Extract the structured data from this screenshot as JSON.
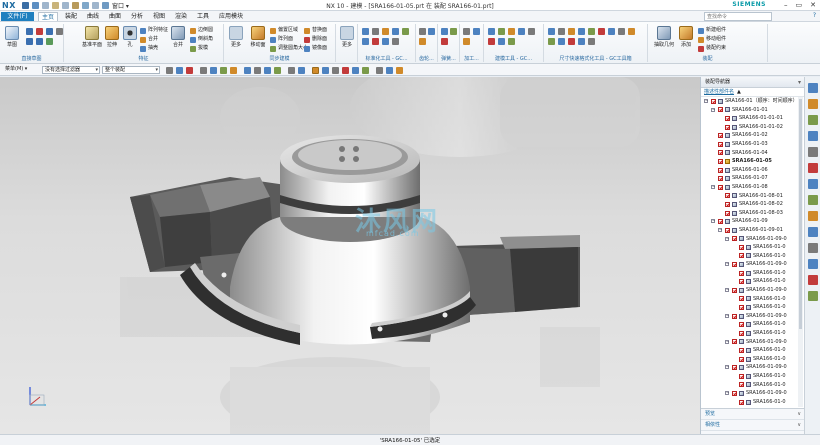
{
  "app": {
    "logo": "NX",
    "window_menu": "窗口 ▾",
    "title": "NX 10 - 建模 - [SRA166-01-05.prt 在 装配 SRA166-01.prt]",
    "brand": "SIEMENS",
    "window_controls": [
      "–",
      "▭",
      "✕"
    ]
  },
  "tabs": [
    {
      "label": "文件(F)",
      "kind": "file"
    },
    {
      "label": "主页",
      "kind": "active"
    },
    {
      "label": "装配"
    },
    {
      "label": "曲线"
    },
    {
      "label": "曲面"
    },
    {
      "label": "分析"
    },
    {
      "label": "视图"
    },
    {
      "label": "渲染"
    },
    {
      "label": "工具"
    },
    {
      "label": "应用模块"
    }
  ],
  "command_search": {
    "placeholder": "查找命令"
  },
  "ribbon": {
    "groups": [
      {
        "label": "直接草图"
      },
      {
        "label": "特征"
      },
      {
        "label": "同步建模"
      },
      {
        "label": "标准化工具 - GC..."
      },
      {
        "label": "齿轮..."
      },
      {
        "label": "弹簧..."
      },
      {
        "label": "加工..."
      },
      {
        "label": "建模工具 - GC..."
      },
      {
        "label": "尺寸快速格式化工具 - GC工具箱"
      },
      {
        "label": "装配"
      }
    ],
    "big_buttons": {
      "sketch": "草图",
      "datum_plane": "基准平面",
      "extrude": "拉伸",
      "hole": "孔",
      "combine": "合并",
      "move_face": "移动面",
      "more": "更多",
      "more2": "更多",
      "more3": "更多",
      "assembly_nav": "抽取几何",
      "add": "添加"
    },
    "small_items": {
      "array_feature": "阵列特征",
      "boolean": "合并",
      "shell": "抽壳",
      "edge_blend": "边倒圆",
      "chamfer": "倒斜角",
      "draft": "拔模",
      "offset_region": "偏置区域",
      "replace_face": "替换面",
      "resize_blend": "调整圆角大小",
      "delete_face": "删除面",
      "pattern_face": "阵列面",
      "mirror_face": "镜像面",
      "move_comp": "移动组件",
      "assembly_constraints": "装配约束",
      "new_component": "新建组件"
    }
  },
  "toolbar": {
    "menu_label": "菜单(M) ▾",
    "filter_value": "没有选择过滤器",
    "scope_value": "整个装配"
  },
  "viewport": {
    "watermark_text": "沐风网",
    "watermark_url": "mfcad.com"
  },
  "navigator": {
    "title": "装配导航器",
    "column_label": "描述性部件名",
    "sort_indicator": "▲",
    "nodes": [
      {
        "label": "SRA166-01（顺序：时间顺序）",
        "level": 0,
        "exp": "−",
        "type": "assembly"
      },
      {
        "label": "SRA166-01-01",
        "level": 1,
        "exp": "−",
        "type": "assembly"
      },
      {
        "label": "SRA166-01-01-01",
        "level": 2,
        "type": "part"
      },
      {
        "label": "SRA166-01-01-02",
        "level": 2,
        "type": "part"
      },
      {
        "label": "SRA166-01-02",
        "level": 1,
        "type": "part"
      },
      {
        "label": "SRA166-01-03",
        "level": 1,
        "type": "part"
      },
      {
        "label": "SRA166-01-04",
        "level": 1,
        "type": "part"
      },
      {
        "label": "SRA166-01-05",
        "level": 1,
        "type": "active",
        "bold": true
      },
      {
        "label": "SRA166-01-06",
        "level": 1,
        "type": "part"
      },
      {
        "label": "SRA166-01-07",
        "level": 1,
        "type": "part"
      },
      {
        "label": "SRA166-01-08",
        "level": 1,
        "exp": "−",
        "type": "assembly"
      },
      {
        "label": "SRA166-01-08-01",
        "level": 2,
        "type": "part"
      },
      {
        "label": "SRA166-01-08-02",
        "level": 2,
        "type": "part"
      },
      {
        "label": "SRA166-01-08-03",
        "level": 2,
        "type": "part"
      },
      {
        "label": "SRA166-01-09",
        "level": 1,
        "exp": "−",
        "type": "assembly"
      },
      {
        "label": "SRA166-01-09-01",
        "level": 2,
        "exp": "−",
        "type": "assembly"
      },
      {
        "label": "SRA166-01-09-0",
        "level": 3,
        "exp": "−",
        "type": "assembly"
      },
      {
        "label": "SRA166-01-0",
        "level": 4,
        "type": "part"
      },
      {
        "label": "SRA166-01-0",
        "level": 4,
        "type": "part"
      },
      {
        "label": "SRA166-01-09-0",
        "level": 3,
        "exp": "−",
        "type": "assembly"
      },
      {
        "label": "SRA166-01-0",
        "level": 4,
        "type": "part"
      },
      {
        "label": "SRA166-01-0",
        "level": 4,
        "type": "part"
      },
      {
        "label": "SRA166-01-09-0",
        "level": 3,
        "exp": "−",
        "type": "assembly"
      },
      {
        "label": "SRA166-01-0",
        "level": 4,
        "type": "part"
      },
      {
        "label": "SRA166-01-0",
        "level": 4,
        "type": "part"
      },
      {
        "label": "SRA166-01-09-0",
        "level": 3,
        "exp": "−",
        "type": "assembly"
      },
      {
        "label": "SRA166-01-0",
        "level": 4,
        "type": "part"
      },
      {
        "label": "SRA166-01-0",
        "level": 4,
        "type": "part"
      },
      {
        "label": "SRA166-01-09-0",
        "level": 3,
        "exp": "−",
        "type": "assembly"
      },
      {
        "label": "SRA166-01-0",
        "level": 4,
        "type": "part"
      },
      {
        "label": "SRA166-01-0",
        "level": 4,
        "type": "part"
      },
      {
        "label": "SRA166-01-09-0",
        "level": 3,
        "exp": "−",
        "type": "assembly"
      },
      {
        "label": "SRA166-01-0",
        "level": 4,
        "type": "part"
      },
      {
        "label": "SRA166-01-0",
        "level": 4,
        "type": "part"
      },
      {
        "label": "SRA166-01-09-0",
        "level": 3,
        "exp": "−",
        "type": "assembly"
      },
      {
        "label": "SRA166-01-0",
        "level": 4,
        "type": "part"
      }
    ],
    "footer": [
      "预览",
      "相依性"
    ]
  },
  "status": {
    "text": "'SRA166-01-05' 已选定"
  },
  "colors": {
    "accent": "#1f7fbf",
    "active_part": "#d49a1c",
    "checkbox": "#c11111"
  }
}
